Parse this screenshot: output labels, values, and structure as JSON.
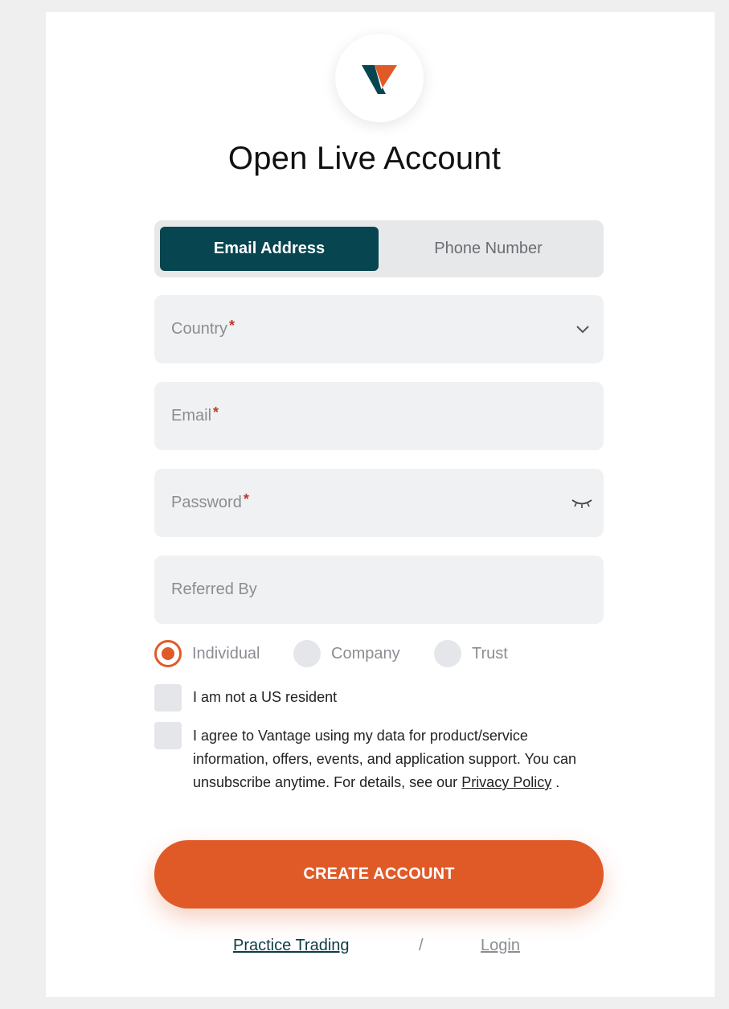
{
  "logo": {
    "icon": "vantage-logo-icon",
    "colors": {
      "teal": "#074650",
      "orange": "#e05a28"
    }
  },
  "title": "Open Live Account",
  "tabs": {
    "email": "Email Address",
    "phone": "Phone Number",
    "selected": "email"
  },
  "fields": {
    "country": {
      "label": "Country",
      "required": "*",
      "icon": "chevron-down-icon"
    },
    "email": {
      "label": "Email",
      "required": "*"
    },
    "password": {
      "label": "Password",
      "required": "*",
      "icon": "eye-closed-icon"
    },
    "referred": {
      "label": "Referred By"
    }
  },
  "account_type": {
    "options": [
      "Individual",
      "Company",
      "Trust"
    ],
    "selected": "Individual"
  },
  "checks": {
    "us_resident": "I am not a US resident",
    "consent_text": "I agree to Vantage using my data for product/service information, offers, events, and application support. You can unsubscribe anytime. For details, see our",
    "privacy_link": "Privacy Policy",
    "consent_end": " ."
  },
  "cta": "CREATE ACCOUNT",
  "footer": {
    "practice": "Practice Trading",
    "separator": "/",
    "login": "Login"
  },
  "colors": {
    "accent": "#e05a28",
    "tab_active": "#074650",
    "field_bg": "#f0f1f2"
  }
}
